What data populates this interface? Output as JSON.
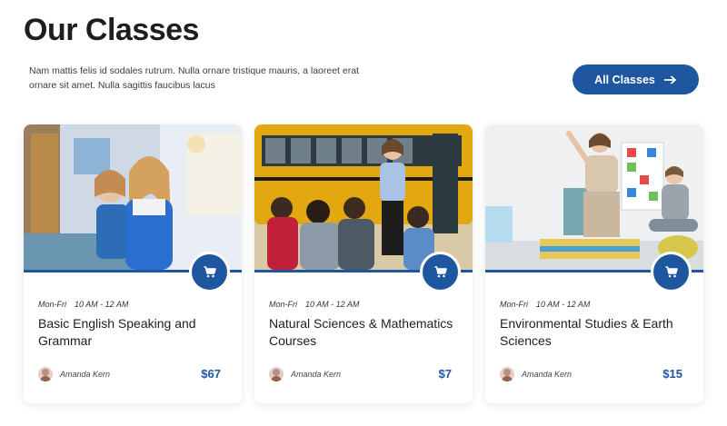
{
  "section": {
    "title": "Our Classes",
    "intro": "Nam mattis felis id sodales rutrum. Nulla ornare tristique mauris, a laoreet erat ornare sit amet. Nulla sagittis faucibus lacus",
    "all_button": "All Classes"
  },
  "colors": {
    "accent": "#1f56a0",
    "text": "#1e1e1e"
  },
  "cards": [
    {
      "days": "Mon-Fri",
      "time": "10 AM - 12 AM",
      "title": "Basic English Speaking and Grammar",
      "author": "Amanda Kern",
      "price": "$67",
      "icon": "cart-icon"
    },
    {
      "days": "Mon-Fri",
      "time": "10 AM - 12 AM",
      "title": "Natural Sciences & Mathematics Courses",
      "author": "Amanda Kern",
      "price": "$7",
      "icon": "cart-icon"
    },
    {
      "days": "Mon-Fri",
      "time": "10 AM - 12 AM",
      "title": "Environmental Studies & Earth Sciences",
      "author": "Amanda Kern",
      "price": "$15",
      "icon": "cart-icon"
    }
  ]
}
